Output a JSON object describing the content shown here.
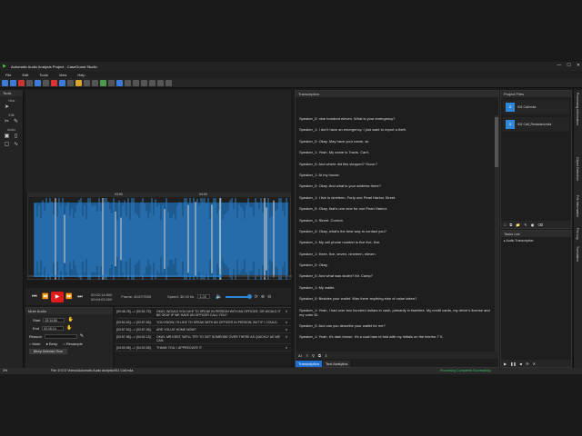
{
  "window": {
    "title": "Automatic Audio Analysis Project - CaseGuard Studio",
    "minimize": "—",
    "maximize": "☐",
    "close": "✕"
  },
  "menu": [
    "File",
    "Edit",
    "Tools",
    "View",
    "Help"
  ],
  "tools_panel": {
    "title": "Tools",
    "sections": [
      "View",
      "Edit",
      "Audio"
    ]
  },
  "ruler": {
    "marks": [
      "03:00",
      "03:03"
    ]
  },
  "transport": {
    "time_main": "00:02:14.800",
    "time_total": "00:04:03.000",
    "frame": "Frame: 4047/7559",
    "speed_label": "Speed: 30.00 f/s",
    "rate": "1.00"
  },
  "mute_audio": {
    "title": "Mute Audio",
    "start_label": "Start",
    "start_value": "02:14.80",
    "end_label": "End",
    "end_value": "02:15.14",
    "reason_label": "Reason",
    "mute_option": "Mute",
    "beep_option": "Beep",
    "resample_option": "Resample",
    "button": "Bleep Selected Time"
  },
  "mute_list": [
    {
      "time": "[03:46.78] --> [03:51.73]:",
      "text": "OKAY, WOULD YOU LIKE TO SPEAK IN PERSON WITH AN OFFICER, OR WOULD IT BE OKAY IF WE HAVE AN OFFICER CALL YOU?"
    },
    {
      "time": "[03:52.63] --> [03:57.53]:",
      "text": "YOU KNOW, I'D LIKE TO SPEAK WITH AN OFFICER IN PERSON, BUT IF I COULD."
    },
    {
      "time": "[03:57.53] --> [03:57.93]:",
      "text": "ARE YOU AT HOME NOW?"
    },
    {
      "time": "[03:57.98] --> [04:02.13]:",
      "text": "OKAY, MR KENT, WE'LL TRY TO GET SOMEONE OVER THERE AS QUICKLY AS WE CAN."
    },
    {
      "time": "[04:00.98] --> [04:02.53]:",
      "text": "THANK YOU. I APPRECIATE IT."
    }
  ],
  "transcript": {
    "title": "Transcription",
    "lines": [
      "Speaker_0: nine hundred eleven. What is your emergency?",
      "Speaker_1: I don't have an emergency. I just want to report a theft.",
      "Speaker_0: Okay. May have your name, sir.",
      "Speaker_1: Yeah. My name is Travis. Can't.",
      "Speaker_0: And where did this stepped? Occur?",
      "Speaker_1: At my house.",
      "Speaker_0: Okay. And what is your address there?",
      "Speaker_1: I live in nineteen. Forty one Pearl Harbor Street.",
      "Speaker_0: Okay, that's one nine for one Pearl Harbor.",
      "Speaker_1: Street. Correct.",
      "Speaker_0: Okay, what's the best way to contact you?",
      "Speaker_1: My cell phone number is five five, five.",
      "Speaker_1: three. five, seven, nineteen, eleven.",
      "Speaker_0: Okay.",
      "Speaker_0: And what was stolen? Mr. Camp?",
      "Speaker_1: My wallet.",
      "Speaker_0: Besides your wallet. Was there anything else of value taken?",
      "Speaker_1: Yeah, I had over two hundred dollars in cash, primarily in twenties. My credit cards, my driver's license and my voter ID.",
      "Speaker_0: And can you describe your wallet for me?",
      "Speaker_1: Yeah, it's dark brown. It's a coal ham bi fold with my initials on the interior T K."
    ],
    "tab_active": "Transcription",
    "tab_other": "Text Analytics"
  },
  "project_files": {
    "title": "Project Files",
    "files": [
      "911 Call.m4a",
      "911 Call_Redacted.m4a"
    ]
  },
  "tasks": {
    "title": "Tasks List",
    "items": [
      "Audio Transcription"
    ]
  },
  "side_tabs": [
    "Processing Information",
    "Object Detection",
    "File Information",
    "File Log",
    "Translation"
  ],
  "status": {
    "zoom": "3%",
    "path": "File: D:\\CG Videos\\Automatic Audio Analysis\\911 Call.m4a",
    "message": "Processing Completed Successfully."
  }
}
